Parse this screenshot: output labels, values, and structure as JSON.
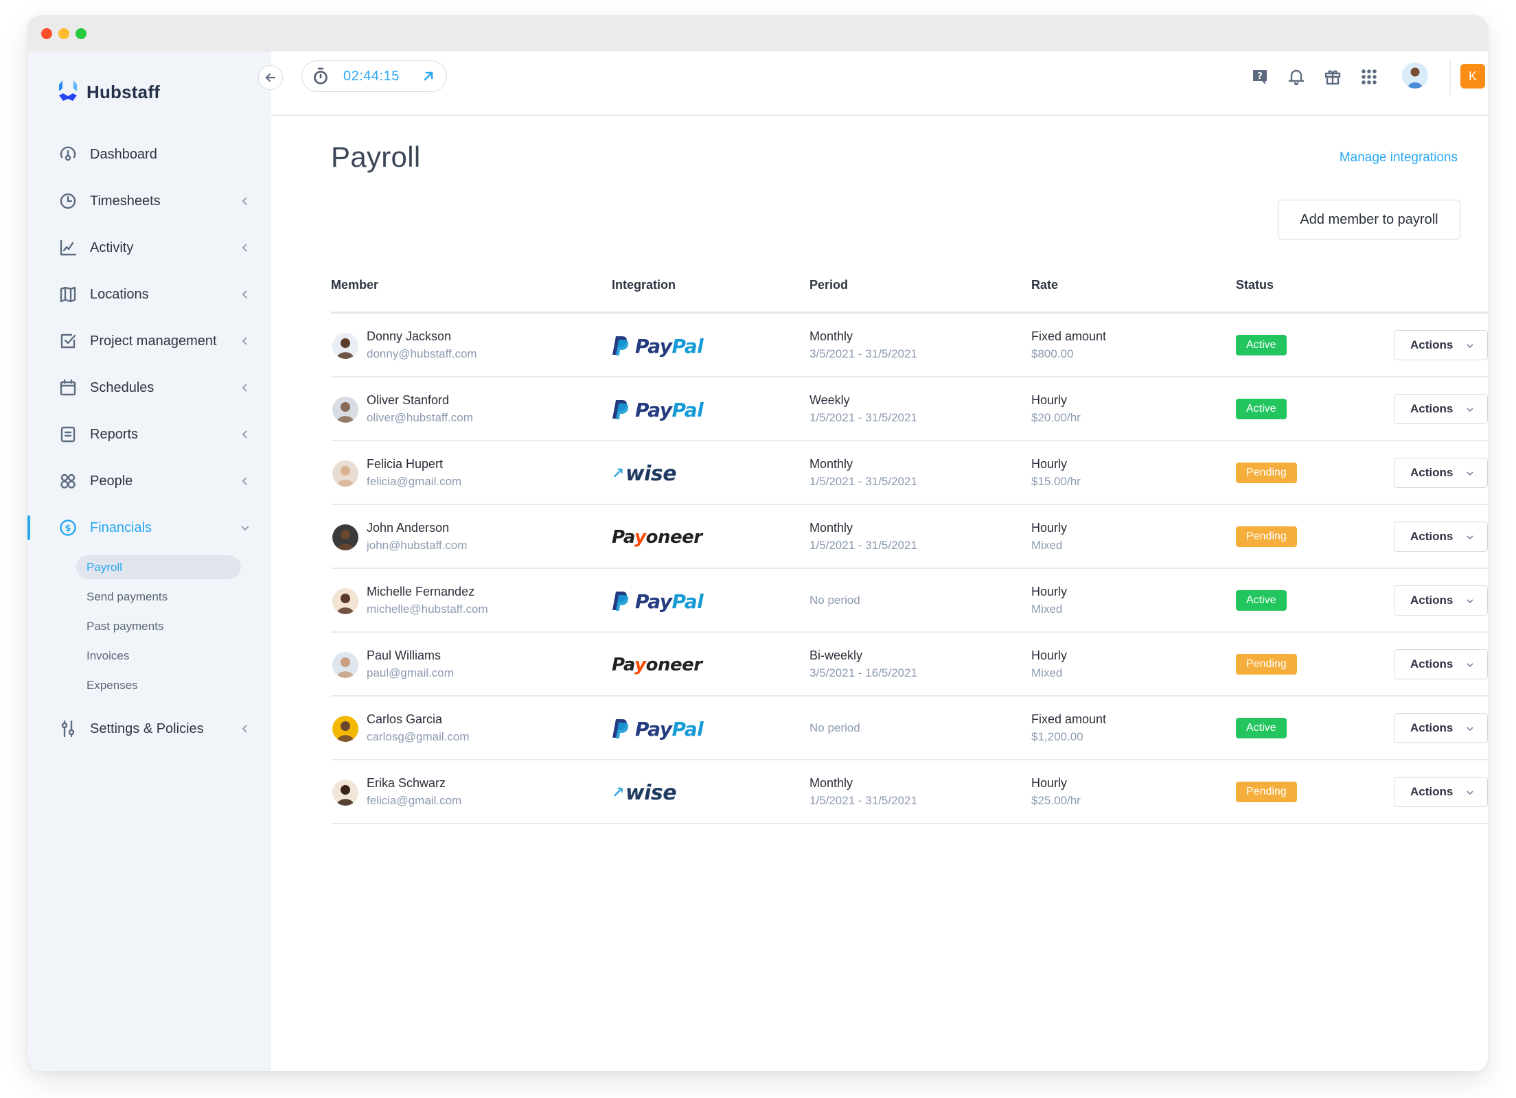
{
  "window": {
    "controls": [
      "close",
      "minimize",
      "zoom"
    ]
  },
  "brand": {
    "name": "Hubstaff",
    "icon": "hubstaff-logo-icon"
  },
  "sidebar": {
    "items": [
      {
        "label": "Dashboard",
        "icon": "dashboard-gauge-icon",
        "has_chevron": false
      },
      {
        "label": "Timesheets",
        "icon": "clock-icon",
        "has_chevron": true
      },
      {
        "label": "Activity",
        "icon": "activity-chart-icon",
        "has_chevron": true
      },
      {
        "label": "Locations",
        "icon": "map-icon",
        "has_chevron": true
      },
      {
        "label": "Project management",
        "icon": "checkbox-icon",
        "has_chevron": true
      },
      {
        "label": "Schedules",
        "icon": "calendar-icon",
        "has_chevron": true
      },
      {
        "label": "Reports",
        "icon": "report-icon",
        "has_chevron": true
      },
      {
        "label": "People",
        "icon": "people-icon",
        "has_chevron": true
      },
      {
        "label": "Financials",
        "icon": "dollar-circle-icon",
        "expanded": true,
        "active": true
      },
      {
        "label": "Settings & Policies",
        "icon": "sliders-icon",
        "has_chevron": true
      }
    ],
    "financials_sub": [
      {
        "label": "Payroll",
        "active": true
      },
      {
        "label": "Send payments"
      },
      {
        "label": "Past payments"
      },
      {
        "label": "Invoices"
      },
      {
        "label": "Expenses"
      }
    ]
  },
  "topbar": {
    "timer": "02:44:15",
    "icons": [
      "help-icon",
      "bell-icon",
      "gift-icon",
      "apps-grid-icon"
    ],
    "org_initial": "K"
  },
  "page": {
    "title": "Payroll",
    "manage_link": "Manage integrations",
    "add_button": "Add member to payroll"
  },
  "table": {
    "columns": [
      "Member",
      "Integration",
      "Period",
      "Rate",
      "Status"
    ],
    "action_label": "Actions",
    "rows": [
      {
        "name": "Donny Jackson",
        "email": "donny@hubstaff.com",
        "integration": "PayPal",
        "period": "Monthly",
        "period_range": "3/5/2021 - 31/5/2021",
        "rate": "Fixed amount",
        "rate_value": "$800.00",
        "status": "Active"
      },
      {
        "name": "Oliver Stanford",
        "email": "oliver@hubstaff.com",
        "integration": "PayPal",
        "period": "Weekly",
        "period_range": "1/5/2021 - 31/5/2021",
        "rate": "Hourly",
        "rate_value": "$20.00/hr",
        "status": "Active"
      },
      {
        "name": "Felicia Hupert",
        "email": "felicia@gmail.com",
        "integration": "Wise",
        "period": "Monthly",
        "period_range": "1/5/2021 - 31/5/2021",
        "rate": "Hourly",
        "rate_value": "$15.00/hr",
        "status": "Pending"
      },
      {
        "name": "John Anderson",
        "email": "john@hubstaff.com",
        "integration": "Payoneer",
        "period": "Monthly",
        "period_range": "1/5/2021 - 31/5/2021",
        "rate": "Hourly",
        "rate_value": "Mixed",
        "status": "Pending"
      },
      {
        "name": "Michelle Fernandez",
        "email": "michelle@hubstaff.com",
        "integration": "PayPal",
        "period": "No period",
        "period_range": "",
        "rate": "Hourly",
        "rate_value": "Mixed",
        "status": "Active"
      },
      {
        "name": "Paul Williams",
        "email": "paul@gmail.com",
        "integration": "Payoneer",
        "period": "Bi-weekly",
        "period_range": "3/5/2021 - 16/5/2021",
        "rate": "Hourly",
        "rate_value": "Mixed",
        "status": "Pending"
      },
      {
        "name": "Carlos Garcia",
        "email": "carlosg@gmail.com",
        "integration": "PayPal",
        "period": "No period",
        "period_range": "",
        "rate": "Fixed amount",
        "rate_value": "$1,200.00",
        "status": "Active"
      },
      {
        "name": "Erika Schwarz",
        "email": "felicia@gmail.com",
        "integration": "Wise",
        "period": "Monthly",
        "period_range": "1/5/2021 - 31/5/2021",
        "rate": "Hourly",
        "rate_value": "$25.00/hr",
        "status": "Pending"
      }
    ]
  },
  "colors": {
    "accent": "#2aa7f2",
    "active": "#22c55e",
    "pending": "#f5ae3c",
    "org_badge": "#fb8c14"
  }
}
